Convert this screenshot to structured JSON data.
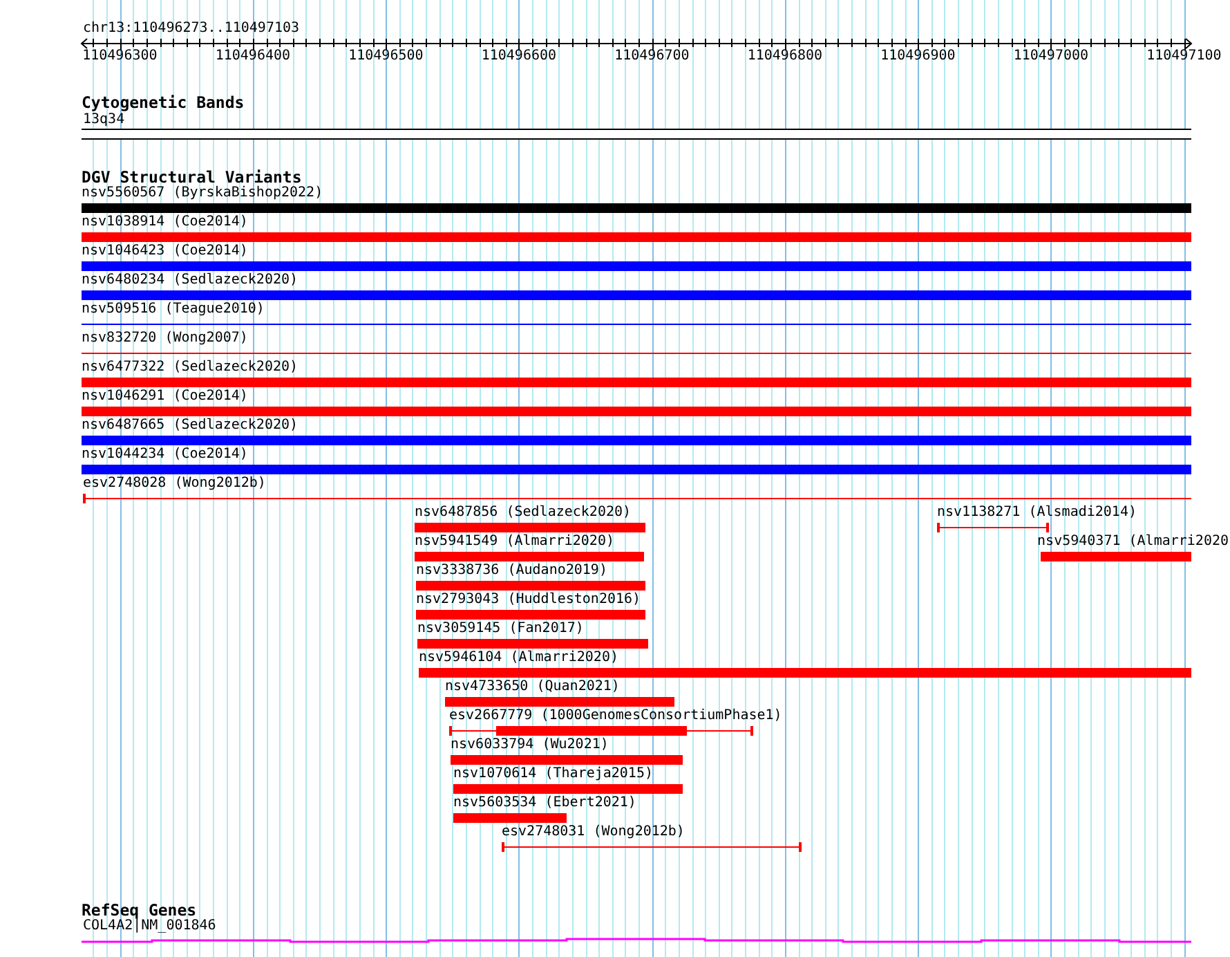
{
  "locus": "chr13:110496273..110497103",
  "ruler": {
    "ticks": [
      "110496300",
      "110496400",
      "110496500",
      "110496600",
      "110496700",
      "110496800",
      "110496900",
      "110497000",
      "110497100"
    ]
  },
  "tracks": [
    {
      "title": "Cytogenetic Bands",
      "features": [
        {
          "label": "13q34",
          "kind": "band"
        }
      ]
    },
    {
      "title": "DGV Structural Variants",
      "features": [
        {
          "label": "nsv5560567 (ByrskaBishop2022)",
          "kind": "thick",
          "color": "#000000"
        },
        {
          "label": "nsv1038914 (Coe2014)",
          "kind": "thick",
          "color": "#ff0000"
        },
        {
          "label": "nsv1046423 (Coe2014)",
          "kind": "thick",
          "color": "#0000ff"
        },
        {
          "label": "nsv6480234 (Sedlazeck2020)",
          "kind": "thick",
          "color": "#0000ff"
        },
        {
          "label": "nsv509516 (Teague2010)",
          "kind": "thin",
          "color": "#0000ff"
        },
        {
          "label": "nsv832720 (Wong2007)",
          "kind": "thin",
          "color": "#ff0000"
        },
        {
          "label": "nsv6477322 (Sedlazeck2020)",
          "kind": "thick",
          "color": "#ff0000"
        },
        {
          "label": "nsv1046291 (Coe2014)",
          "kind": "thick",
          "color": "#ff0000"
        },
        {
          "label": "nsv6487665 (Sedlazeck2020)",
          "kind": "thick",
          "color": "#0000ff"
        },
        {
          "label": "nsv1044234 (Coe2014)",
          "kind": "thick",
          "color": "#0000ff"
        },
        {
          "label": "esv2748028 (Wong2012b)",
          "kind": "whisker",
          "color": "#ff0000"
        },
        {
          "label": "nsv6487856 (Sedlazeck2020)",
          "kind": "thick",
          "color": "#ff0000"
        },
        {
          "label": "nsv1138271 (Alsmadi2014)",
          "kind": "whisker",
          "color": "#ff0000"
        },
        {
          "label": "nsv5941549 (Almarri2020)",
          "kind": "thick",
          "color": "#ff0000"
        },
        {
          "label": "nsv5940371 (Almarri2020",
          "kind": "thick",
          "color": "#ff0000"
        },
        {
          "label": "nsv3338736 (Audano2019)",
          "kind": "thick",
          "color": "#ff0000"
        },
        {
          "label": "nsv2793043 (Huddleston2016)",
          "kind": "thick",
          "color": "#ff0000"
        },
        {
          "label": "nsv3059145 (Fan2017)",
          "kind": "thick",
          "color": "#ff0000"
        },
        {
          "label": "nsv5946104 (Almarri2020)",
          "kind": "thick",
          "color": "#ff0000"
        },
        {
          "label": "nsv4733650 (Quan2021)",
          "kind": "thick",
          "color": "#ff0000"
        },
        {
          "label": "esv2667779 (1000GenomesConsortiumPhase1)",
          "kind": "partial",
          "color": "#ff0000"
        },
        {
          "label": "nsv6033794 (Wu2021)",
          "kind": "thick",
          "color": "#ff0000"
        },
        {
          "label": "nsv1070614 (Thareja2015)",
          "kind": "thick",
          "color": "#ff0000"
        },
        {
          "label": "nsv5603534 (Ebert2021)",
          "kind": "thick",
          "color": "#ff0000"
        },
        {
          "label": "esv2748031 (Wong2012b)",
          "kind": "whisker",
          "color": "#ff0000"
        }
      ]
    },
    {
      "title": "RefSeq Genes",
      "features": [
        {
          "label": "COL4A2|NM_001846",
          "kind": "gene",
          "color": "#ff00ff"
        }
      ]
    }
  ]
}
